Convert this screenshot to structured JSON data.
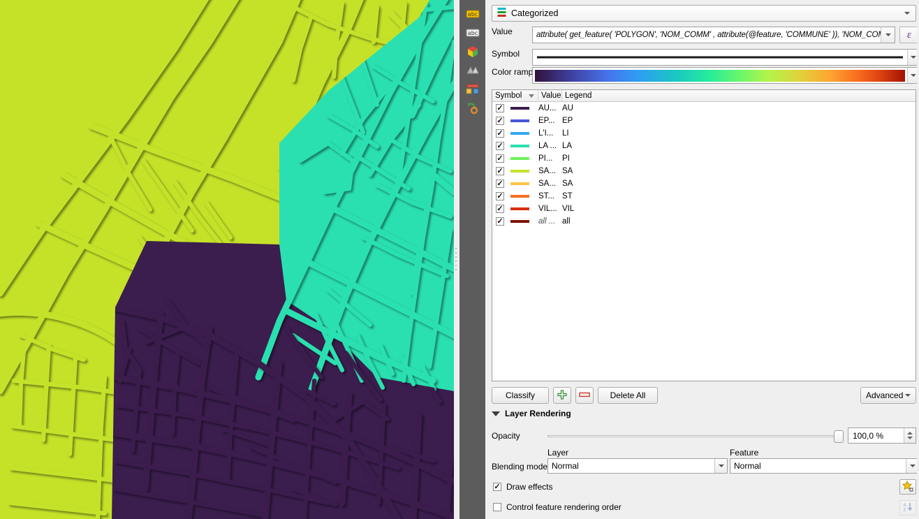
{
  "renderer": {
    "icon": "categorized-symbol-icon",
    "label": "Categorized"
  },
  "fields": {
    "value_label": "Value",
    "value_expression": "attribute( get_feature( 'POLYGON',  'NOM_COMM' , attribute(@feature, 'COMMUNE' )), 'NOM_COMM')",
    "expression_button": "ε",
    "symbol_label": "Symbol",
    "color_ramp_label": "Color ramp"
  },
  "legend": {
    "columns": [
      "Symbol",
      "Value",
      "Legend"
    ],
    "rows": [
      {
        "checked": true,
        "color": "#3b1d4e",
        "value": "AU...",
        "legend": "AU",
        "italic": false
      },
      {
        "checked": true,
        "color": "#4758d4",
        "value": "EP...",
        "legend": "EP",
        "italic": false
      },
      {
        "checked": true,
        "color": "#35a8f2",
        "value": "L'I...",
        "legend": "LI",
        "italic": false
      },
      {
        "checked": true,
        "color": "#2ae0b0",
        "value": "LA ...",
        "legend": "LA",
        "italic": false
      },
      {
        "checked": true,
        "color": "#6ef25a",
        "value": "PI...",
        "legend": "PI",
        "italic": false
      },
      {
        "checked": true,
        "color": "#c5e229",
        "value": "SA...",
        "legend": "SA",
        "italic": false
      },
      {
        "checked": true,
        "color": "#fcc344",
        "value": "SA...",
        "legend": "SA",
        "italic": false
      },
      {
        "checked": true,
        "color": "#f4701f",
        "value": "ST...",
        "legend": "ST",
        "italic": false
      },
      {
        "checked": true,
        "color": "#d92f0a",
        "value": "VIL...",
        "legend": "VIL",
        "italic": false
      },
      {
        "checked": true,
        "color": "#7e1105",
        "value": "all ...",
        "legend": "all",
        "italic": true
      }
    ]
  },
  "buttons": {
    "classify": "Classify",
    "add": "add-symbol-icon",
    "remove": "remove-symbol-icon",
    "delete_all": "Delete All",
    "advanced": "Advanced"
  },
  "layer_rendering": {
    "title": "Layer Rendering",
    "opacity_label": "Opacity",
    "opacity_value": "100,0 %",
    "blending_label": "Blending mode",
    "layer_label": "Layer",
    "feature_label": "Feature",
    "layer_blend": "Normal",
    "feature_blend": "Normal",
    "draw_effects": "Draw effects",
    "draw_effects_checked": true,
    "control_order": "Control feature rendering order",
    "control_order_checked": false
  },
  "toolbar": {
    "items": [
      {
        "name": "symbology-brush-icon"
      },
      {
        "name": "labels-abc-icon"
      },
      {
        "name": "masks-abc-icon"
      },
      {
        "name": "3d-view-cube-icon"
      },
      {
        "name": "diagrams-icon"
      },
      {
        "name": "joins-table-icon"
      },
      {
        "name": "actions-icon"
      }
    ]
  },
  "map": {
    "regions": [
      {
        "name": "commune-sa",
        "color": "#c5e229"
      },
      {
        "name": "commune-la",
        "color": "#2ae0b0"
      },
      {
        "name": "commune-au",
        "color": "#3b1d4e"
      }
    ]
  }
}
